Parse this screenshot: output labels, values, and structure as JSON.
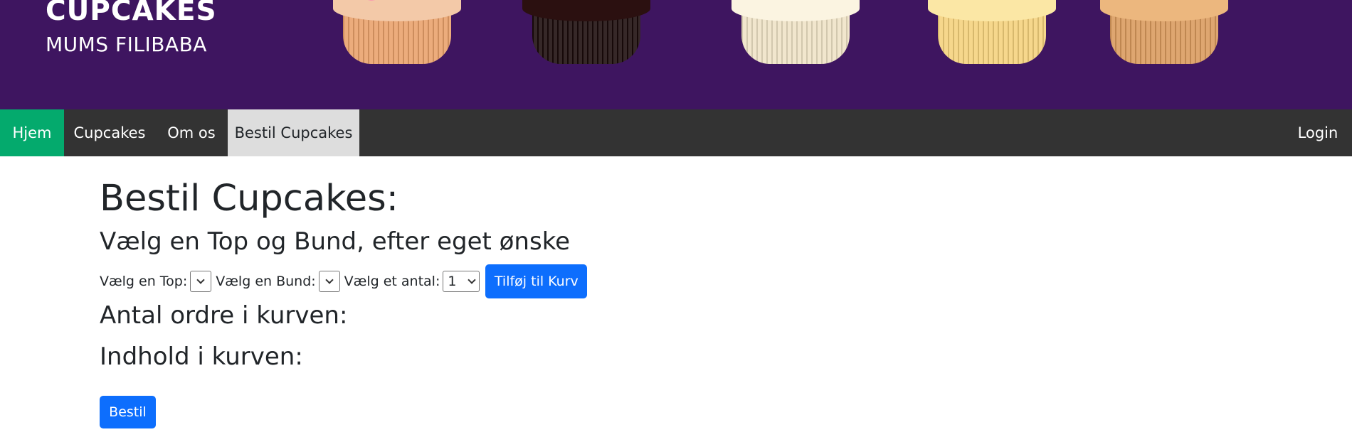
{
  "header": {
    "brand_title": "CUPCAKES",
    "brand_subtitle": "MUMS FILIBABA",
    "background_color": "#3e1560"
  },
  "nav": {
    "items": [
      {
        "label": "Hjem",
        "active": true,
        "color": "#04aa6d"
      },
      {
        "label": "Cupcakes"
      },
      {
        "label": "Om os"
      },
      {
        "label": "Bestil Cupcakes",
        "selected": true,
        "color": "#dddddd"
      }
    ],
    "login_label": "Login",
    "background_color": "#333333"
  },
  "main": {
    "title": "Bestil Cupcakes:",
    "subtitle": "Vælg en Top og Bund, efter eget ønske",
    "form": {
      "top_label": "Vælg en Top:",
      "top_value": "",
      "bottom_label": "Vælg en Bund:",
      "bottom_value": "",
      "quantity_label": "Vælg et antal:",
      "quantity_value": "1",
      "add_button_label": "Tilføj til Kurv"
    },
    "cart_count_heading": "Antal ordre i kurven:",
    "cart_contents_heading": "Indhold i kurven:",
    "order_button_label": "Bestil",
    "button_color": "#0d6efd"
  }
}
